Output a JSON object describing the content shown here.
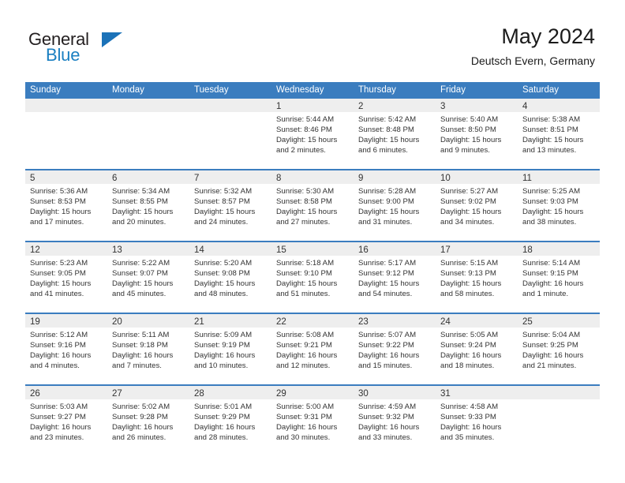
{
  "brand": {
    "name_top": "General",
    "name_bottom": "Blue",
    "accent_color": "#1b72b8",
    "triangle_icon": "triangle-icon"
  },
  "header": {
    "title": "May 2024",
    "subtitle": "Deutsch Evern, Germany"
  },
  "theme": {
    "header_blue": "#3b7dbf",
    "date_band_gray": "#eeeeee",
    "text_color": "#333333"
  },
  "calendar": {
    "day_headers": [
      "Sunday",
      "Monday",
      "Tuesday",
      "Wednesday",
      "Thursday",
      "Friday",
      "Saturday"
    ],
    "labels": {
      "sunrise": "Sunrise:",
      "sunset": "Sunset:",
      "daylight": "Daylight:"
    },
    "weeks": [
      [
        {
          "day": "",
          "sunrise": "",
          "sunset": "",
          "daylight_1": "",
          "daylight_2": ""
        },
        {
          "day": "",
          "sunrise": "",
          "sunset": "",
          "daylight_1": "",
          "daylight_2": ""
        },
        {
          "day": "",
          "sunrise": "",
          "sunset": "",
          "daylight_1": "",
          "daylight_2": ""
        },
        {
          "day": "1",
          "sunrise": "Sunrise: 5:44 AM",
          "sunset": "Sunset: 8:46 PM",
          "daylight_1": "Daylight: 15 hours",
          "daylight_2": "and 2 minutes."
        },
        {
          "day": "2",
          "sunrise": "Sunrise: 5:42 AM",
          "sunset": "Sunset: 8:48 PM",
          "daylight_1": "Daylight: 15 hours",
          "daylight_2": "and 6 minutes."
        },
        {
          "day": "3",
          "sunrise": "Sunrise: 5:40 AM",
          "sunset": "Sunset: 8:50 PM",
          "daylight_1": "Daylight: 15 hours",
          "daylight_2": "and 9 minutes."
        },
        {
          "day": "4",
          "sunrise": "Sunrise: 5:38 AM",
          "sunset": "Sunset: 8:51 PM",
          "daylight_1": "Daylight: 15 hours",
          "daylight_2": "and 13 minutes."
        }
      ],
      [
        {
          "day": "5",
          "sunrise": "Sunrise: 5:36 AM",
          "sunset": "Sunset: 8:53 PM",
          "daylight_1": "Daylight: 15 hours",
          "daylight_2": "and 17 minutes."
        },
        {
          "day": "6",
          "sunrise": "Sunrise: 5:34 AM",
          "sunset": "Sunset: 8:55 PM",
          "daylight_1": "Daylight: 15 hours",
          "daylight_2": "and 20 minutes."
        },
        {
          "day": "7",
          "sunrise": "Sunrise: 5:32 AM",
          "sunset": "Sunset: 8:57 PM",
          "daylight_1": "Daylight: 15 hours",
          "daylight_2": "and 24 minutes."
        },
        {
          "day": "8",
          "sunrise": "Sunrise: 5:30 AM",
          "sunset": "Sunset: 8:58 PM",
          "daylight_1": "Daylight: 15 hours",
          "daylight_2": "and 27 minutes."
        },
        {
          "day": "9",
          "sunrise": "Sunrise: 5:28 AM",
          "sunset": "Sunset: 9:00 PM",
          "daylight_1": "Daylight: 15 hours",
          "daylight_2": "and 31 minutes."
        },
        {
          "day": "10",
          "sunrise": "Sunrise: 5:27 AM",
          "sunset": "Sunset: 9:02 PM",
          "daylight_1": "Daylight: 15 hours",
          "daylight_2": "and 34 minutes."
        },
        {
          "day": "11",
          "sunrise": "Sunrise: 5:25 AM",
          "sunset": "Sunset: 9:03 PM",
          "daylight_1": "Daylight: 15 hours",
          "daylight_2": "and 38 minutes."
        }
      ],
      [
        {
          "day": "12",
          "sunrise": "Sunrise: 5:23 AM",
          "sunset": "Sunset: 9:05 PM",
          "daylight_1": "Daylight: 15 hours",
          "daylight_2": "and 41 minutes."
        },
        {
          "day": "13",
          "sunrise": "Sunrise: 5:22 AM",
          "sunset": "Sunset: 9:07 PM",
          "daylight_1": "Daylight: 15 hours",
          "daylight_2": "and 45 minutes."
        },
        {
          "day": "14",
          "sunrise": "Sunrise: 5:20 AM",
          "sunset": "Sunset: 9:08 PM",
          "daylight_1": "Daylight: 15 hours",
          "daylight_2": "and 48 minutes."
        },
        {
          "day": "15",
          "sunrise": "Sunrise: 5:18 AM",
          "sunset": "Sunset: 9:10 PM",
          "daylight_1": "Daylight: 15 hours",
          "daylight_2": "and 51 minutes."
        },
        {
          "day": "16",
          "sunrise": "Sunrise: 5:17 AM",
          "sunset": "Sunset: 9:12 PM",
          "daylight_1": "Daylight: 15 hours",
          "daylight_2": "and 54 minutes."
        },
        {
          "day": "17",
          "sunrise": "Sunrise: 5:15 AM",
          "sunset": "Sunset: 9:13 PM",
          "daylight_1": "Daylight: 15 hours",
          "daylight_2": "and 58 minutes."
        },
        {
          "day": "18",
          "sunrise": "Sunrise: 5:14 AM",
          "sunset": "Sunset: 9:15 PM",
          "daylight_1": "Daylight: 16 hours",
          "daylight_2": "and 1 minute."
        }
      ],
      [
        {
          "day": "19",
          "sunrise": "Sunrise: 5:12 AM",
          "sunset": "Sunset: 9:16 PM",
          "daylight_1": "Daylight: 16 hours",
          "daylight_2": "and 4 minutes."
        },
        {
          "day": "20",
          "sunrise": "Sunrise: 5:11 AM",
          "sunset": "Sunset: 9:18 PM",
          "daylight_1": "Daylight: 16 hours",
          "daylight_2": "and 7 minutes."
        },
        {
          "day": "21",
          "sunrise": "Sunrise: 5:09 AM",
          "sunset": "Sunset: 9:19 PM",
          "daylight_1": "Daylight: 16 hours",
          "daylight_2": "and 10 minutes."
        },
        {
          "day": "22",
          "sunrise": "Sunrise: 5:08 AM",
          "sunset": "Sunset: 9:21 PM",
          "daylight_1": "Daylight: 16 hours",
          "daylight_2": "and 12 minutes."
        },
        {
          "day": "23",
          "sunrise": "Sunrise: 5:07 AM",
          "sunset": "Sunset: 9:22 PM",
          "daylight_1": "Daylight: 16 hours",
          "daylight_2": "and 15 minutes."
        },
        {
          "day": "24",
          "sunrise": "Sunrise: 5:05 AM",
          "sunset": "Sunset: 9:24 PM",
          "daylight_1": "Daylight: 16 hours",
          "daylight_2": "and 18 minutes."
        },
        {
          "day": "25",
          "sunrise": "Sunrise: 5:04 AM",
          "sunset": "Sunset: 9:25 PM",
          "daylight_1": "Daylight: 16 hours",
          "daylight_2": "and 21 minutes."
        }
      ],
      [
        {
          "day": "26",
          "sunrise": "Sunrise: 5:03 AM",
          "sunset": "Sunset: 9:27 PM",
          "daylight_1": "Daylight: 16 hours",
          "daylight_2": "and 23 minutes."
        },
        {
          "day": "27",
          "sunrise": "Sunrise: 5:02 AM",
          "sunset": "Sunset: 9:28 PM",
          "daylight_1": "Daylight: 16 hours",
          "daylight_2": "and 26 minutes."
        },
        {
          "day": "28",
          "sunrise": "Sunrise: 5:01 AM",
          "sunset": "Sunset: 9:29 PM",
          "daylight_1": "Daylight: 16 hours",
          "daylight_2": "and 28 minutes."
        },
        {
          "day": "29",
          "sunrise": "Sunrise: 5:00 AM",
          "sunset": "Sunset: 9:31 PM",
          "daylight_1": "Daylight: 16 hours",
          "daylight_2": "and 30 minutes."
        },
        {
          "day": "30",
          "sunrise": "Sunrise: 4:59 AM",
          "sunset": "Sunset: 9:32 PM",
          "daylight_1": "Daylight: 16 hours",
          "daylight_2": "and 33 minutes."
        },
        {
          "day": "31",
          "sunrise": "Sunrise: 4:58 AM",
          "sunset": "Sunset: 9:33 PM",
          "daylight_1": "Daylight: 16 hours",
          "daylight_2": "and 35 minutes."
        },
        {
          "day": "",
          "sunrise": "",
          "sunset": "",
          "daylight_1": "",
          "daylight_2": ""
        }
      ]
    ]
  }
}
